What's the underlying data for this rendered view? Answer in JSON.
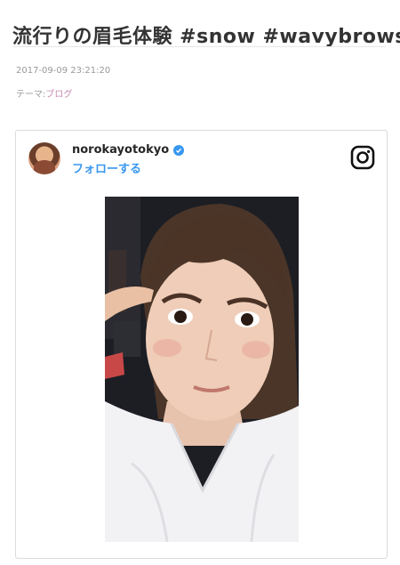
{
  "post": {
    "title": "流行りの眉毛体験 #snow #wavybrows",
    "date": "2017-09-09 23:21:20",
    "theme_label": "テーマ:",
    "theme_value": "ブログ"
  },
  "instagram": {
    "username": "norokayotokyo",
    "follow_label": "フォローする",
    "accent": "#3897f0",
    "icons": [
      "verified-icon",
      "instagram-icon"
    ]
  },
  "colors": {
    "theme_link": "#c58ab0",
    "card_border": "#dbdbdb"
  }
}
